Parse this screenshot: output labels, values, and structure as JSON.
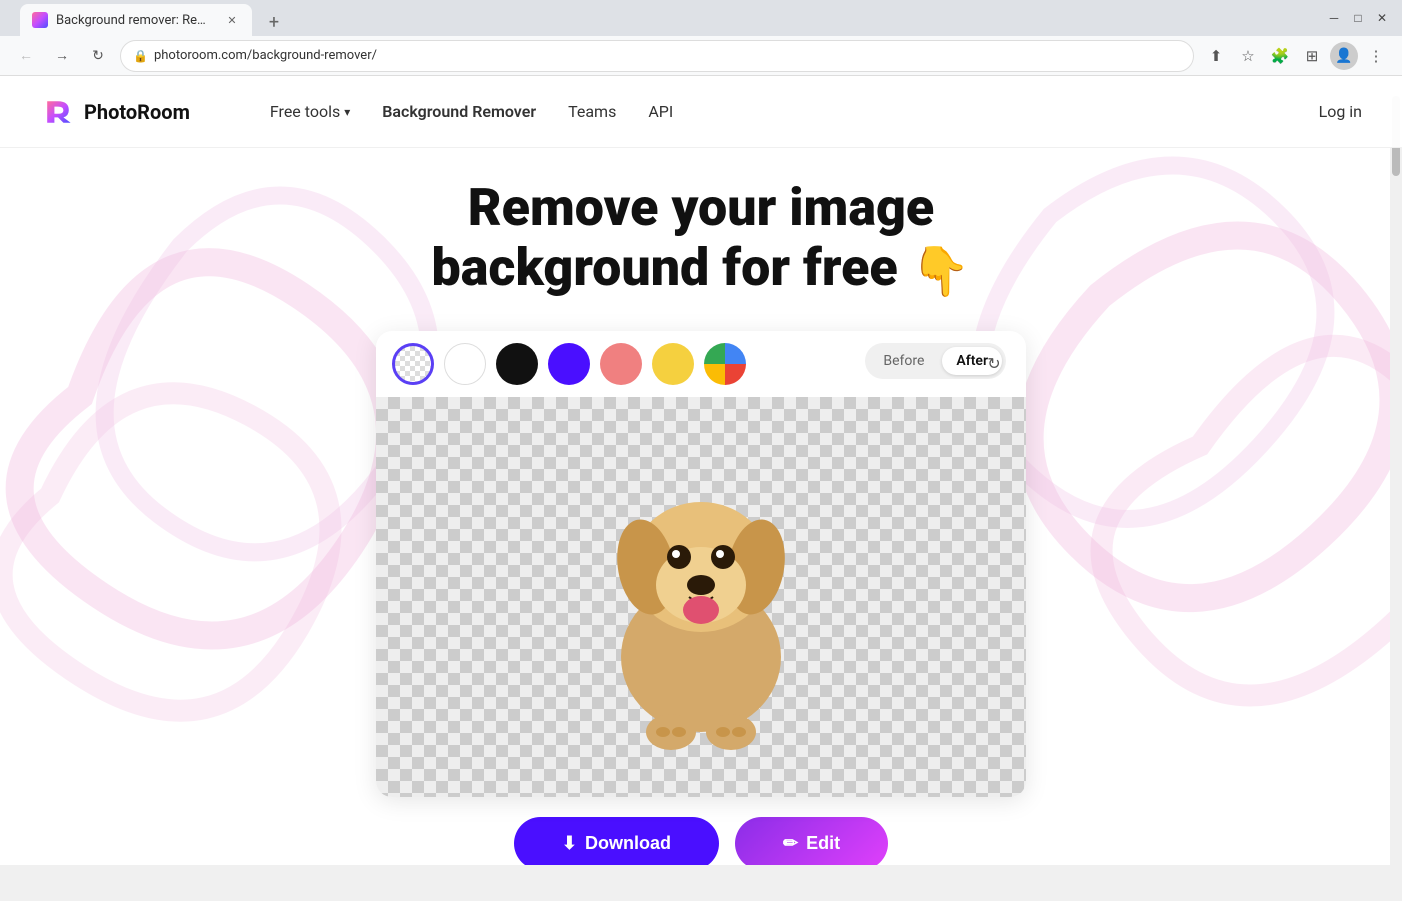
{
  "browser": {
    "tab_title": "Background remover: Remove yo...",
    "tab_favicon": "R",
    "url": "photoroom.com/background-remover/",
    "new_tab_label": "+"
  },
  "nav": {
    "logo_text": "PhotoRoom",
    "links": [
      {
        "label": "Free tools",
        "has_dropdown": true
      },
      {
        "label": "Background Remover",
        "active": true
      },
      {
        "label": "Teams"
      },
      {
        "label": "API"
      }
    ],
    "login_label": "Log in"
  },
  "hero": {
    "title_line1": "Remove your image",
    "title_line2": "background for free",
    "hand_emoji": "👇"
  },
  "color_swatches": [
    {
      "name": "transparent",
      "label": "Transparent"
    },
    {
      "name": "white",
      "label": "White"
    },
    {
      "name": "black",
      "label": "Black"
    },
    {
      "name": "purple",
      "label": "Purple"
    },
    {
      "name": "pink",
      "label": "Pink"
    },
    {
      "name": "yellow",
      "label": "Yellow"
    },
    {
      "name": "multicolor",
      "label": "More colors"
    }
  ],
  "toggle": {
    "before_label": "Before",
    "after_label": "After",
    "active": "After"
  },
  "buttons": {
    "download_label": "Download",
    "download_icon": "⬇",
    "edit_label": "Edit",
    "edit_icon": "✏"
  }
}
